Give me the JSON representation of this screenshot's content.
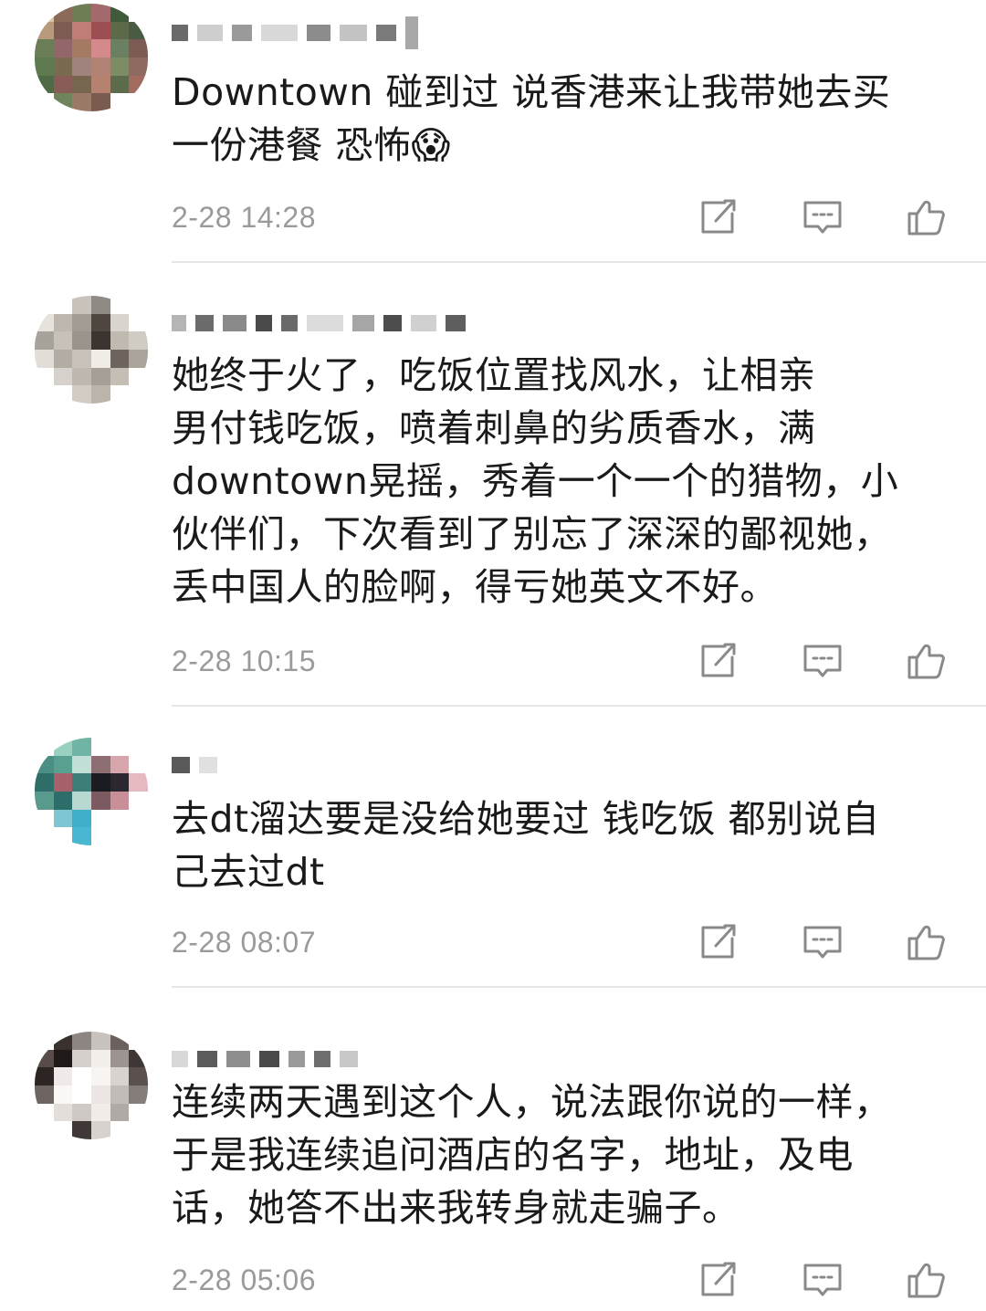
{
  "comments": [
    {
      "text": "Downtown 碰到过 说香港来让我带她去买\n一份港餐 恐怖😱",
      "time": "2-28 14:28"
    },
    {
      "text": "她终于火了，吃饭位置找风水，让相亲\n男付钱吃饭，喷着刺鼻的劣质香水，满\ndowntown晃摇，秀着一个一个的猎物，小\n伙伴们，下次看到了别忘了深深的鄙视她，\n丢中国人的脸啊，得亏她英文不好。",
      "time": "2-28 10:15"
    },
    {
      "text": "去dt溜达要是没给她要过 钱吃饭 都别说自\n己去过dt",
      "time": "2-28 08:07"
    },
    {
      "text": "连续两天遇到这个人，说法跟你说的一样，\n于是我连续追问酒店的名字，地址，及电\n话，她答不出来我转身就走骗子。",
      "time": "2-28 05:06"
    }
  ],
  "icons": {
    "repost": "repost-icon",
    "comment": "comment-icon",
    "like": "thumbs-up-icon"
  },
  "colors": {
    "text": "#1a1a1a",
    "time": "#9a9a9a",
    "icon": "#8a8a8a",
    "divider": "#e6e6e6"
  }
}
